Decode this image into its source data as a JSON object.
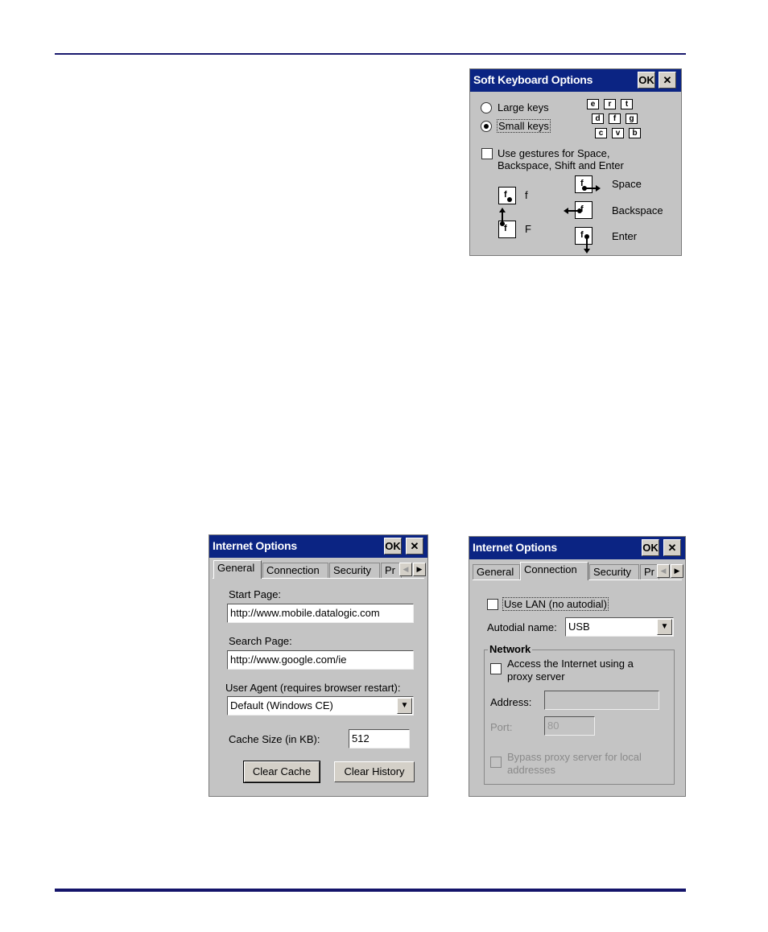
{
  "soft_keyboard": {
    "title": "Soft Keyboard Options",
    "ok_label": "OK",
    "close_label": "✕",
    "large_keys_label": "Large keys",
    "small_keys_label": "Small keys",
    "selected_option": "Small keys",
    "key_rows": [
      [
        "e",
        "r",
        "t"
      ],
      [
        "d",
        "f",
        "g"
      ],
      [
        "c",
        "v",
        "b"
      ]
    ],
    "gestures_label_line1": "Use gestures for Space,",
    "gestures_label_line2": "Backspace, Shift and Enter",
    "gestures_checked": false,
    "gesture_key": "f",
    "gesture_f_lower": "f",
    "gesture_f_upper": "F",
    "gesture_space": "Space",
    "gesture_backspace": "Backspace",
    "gesture_enter": "Enter"
  },
  "internet_general": {
    "title": "Internet Options",
    "ok_label": "OK",
    "close_label": "✕",
    "tabs": [
      "General",
      "Connection",
      "Security",
      "Pr"
    ],
    "active_tab": "General",
    "start_page_label": "Start Page:",
    "start_page_value": "http://www.mobile.datalogic.com",
    "search_page_label": "Search Page:",
    "search_page_value": "http://www.google.com/ie",
    "user_agent_label": "User Agent (requires browser restart):",
    "user_agent_value": "Default (Windows CE)",
    "cache_size_label": "Cache Size (in KB):",
    "cache_size_value": "512",
    "clear_cache_label": "Clear Cache",
    "clear_history_label": "Clear History"
  },
  "internet_connection": {
    "title": "Internet Options",
    "ok_label": "OK",
    "close_label": "✕",
    "tabs": [
      "General",
      "Connection",
      "Security",
      "Pr"
    ],
    "active_tab": "Connection",
    "use_lan_label": "Use LAN (no autodial)",
    "use_lan_checked": false,
    "autodial_label": "Autodial name:",
    "autodial_value": "USB",
    "network_legend": "Network",
    "proxy_label_line1": "Access the Internet using a",
    "proxy_label_line2": "proxy server",
    "address_label": "Address:",
    "address_value": "",
    "port_label": "Port:",
    "port_value": "80",
    "bypass_label_line1": "Bypass proxy server for local",
    "bypass_label_line2": "addresses"
  }
}
